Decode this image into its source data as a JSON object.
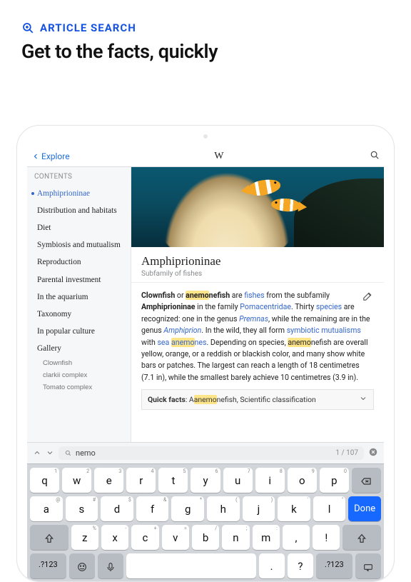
{
  "promo": {
    "label": "ARTICLE SEARCH",
    "title": "Get to the facts, quickly"
  },
  "nav": {
    "back": "Explore",
    "brand": "W"
  },
  "sidebar": {
    "head": "CONTENTS",
    "items": [
      "Amphiprioninae",
      "Distribution and habitats",
      "Diet",
      "Symbiosis and mutualism",
      "Reproduction",
      "Parental investment",
      "In the aquarium",
      "Taxonomy",
      "In popular culture",
      "Gallery"
    ],
    "subitems": [
      "Clownfish",
      "clarkii complex",
      "Tomato complex"
    ]
  },
  "article": {
    "title": "Amphiprioninae",
    "subtitle": "Subfamily of fishes",
    "body": {
      "t1": "Clownfish",
      "t2": " or ",
      "h1": "anemo",
      "t3": "nefish",
      "t4": " are ",
      "l1": "fishes",
      "t5": " from the subfamily ",
      "b1": "Amphiprioninae",
      "t6": " in the family ",
      "l2": "Pomacentridae",
      "t7": ". Thirty ",
      "l3": "species",
      "t8": " are recognized: one in the genus ",
      "l4": "Premnas",
      "t9": ", while the remaining are in the genus ",
      "l5": "Amphiprion",
      "t10": ". In the wild, they all form ",
      "l6": "symbiotic mutualisms",
      "t11": " with ",
      "l7": "sea ",
      "h2": "anemo",
      "t12": "nes",
      "t13": ". Depending on species, ",
      "h3": "anemo",
      "t14": "nefish are overall yellow, orange, or a reddish or blackish color, and many show white bars or patches. The largest can reach a length of 18 centimetres (7.1 in), while the smallest barely achieve 10 centimetres (3.9 in)."
    },
    "quick": {
      "label": "Quick facts",
      "rest": "nefish, Scientific classification"
    }
  },
  "find": {
    "query": "nemo",
    "count": "1 / 107"
  },
  "keyboard": {
    "r1": [
      "q",
      "w",
      "e",
      "r",
      "t",
      "y",
      "u",
      "i",
      "o",
      "p"
    ],
    "n1": [
      "1",
      "2",
      "3",
      "4",
      "5",
      "6",
      "7",
      "8",
      "9",
      "0"
    ],
    "r2": [
      "a",
      "s",
      "d",
      "f",
      "g",
      "h",
      "j",
      "k",
      "l"
    ],
    "p2": [
      "@",
      "#",
      "$",
      "&",
      "*",
      "(",
      ")",
      "'",
      "\""
    ],
    "r3": [
      "z",
      "x",
      "c",
      "v",
      "b",
      "n",
      "m"
    ],
    "p3": [
      "%",
      "-",
      "+",
      "=",
      "/",
      ";",
      ":"
    ],
    "punct": [
      ",",
      "!",
      ".",
      "?"
    ],
    "sym": ".?123",
    "done": "Done"
  }
}
